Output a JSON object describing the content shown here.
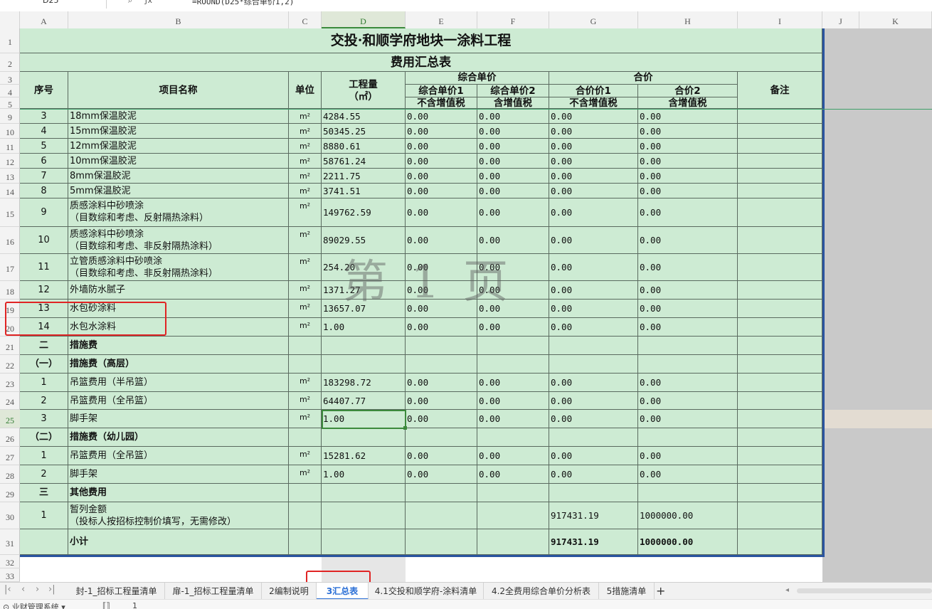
{
  "formula_bar": {
    "name_box": "D25",
    "formula": "=ROUND(D25*综合单价1,2)"
  },
  "columns": [
    "A",
    "B",
    "C",
    "D",
    "E",
    "F",
    "G",
    "H",
    "I",
    "J",
    "K"
  ],
  "title": {
    "line1": "交投·和顺学府地块一涂料工程",
    "line2": "费用汇总表"
  },
  "headers": {
    "seq": "序号",
    "name": "项目名称",
    "unit": "单位",
    "qty": "工程量",
    "qty_unit": "（㎡）",
    "composite_price": "综合单价",
    "total_price": "合价",
    "remark": "备注",
    "price1": "综合单价1",
    "price2": "综合单价2",
    "sum1": "合价价1",
    "sum2": "合价2",
    "ex_tax": "不含增值税",
    "inc_tax": "含增值税",
    "ex_tax2": "不含增值税",
    "inc_tax2": "含增值税"
  },
  "rows": [
    {
      "row": "9",
      "seq": "3",
      "name": "18mm保温胶泥",
      "unit": "m²",
      "qty": "4284.55",
      "p1": "0.00",
      "p2": "0.00",
      "s1": "0.00",
      "s2": "0.00"
    },
    {
      "row": "10",
      "seq": "4",
      "name": "15mm保温胶泥",
      "unit": "m²",
      "qty": "50345.25",
      "p1": "0.00",
      "p2": "0.00",
      "s1": "0.00",
      "s2": "0.00"
    },
    {
      "row": "11",
      "seq": "5",
      "name": "12mm保温胶泥",
      "unit": "m²",
      "qty": "8880.61",
      "p1": "0.00",
      "p2": "0.00",
      "s1": "0.00",
      "s2": "0.00"
    },
    {
      "row": "12",
      "seq": "6",
      "name": "10mm保温胶泥",
      "unit": "m²",
      "qty": "58761.24",
      "p1": "0.00",
      "p2": "0.00",
      "s1": "0.00",
      "s2": "0.00"
    },
    {
      "row": "13",
      "seq": "7",
      "name": "8mm保温胶泥",
      "unit": "m²",
      "qty": "2211.75",
      "p1": "0.00",
      "p2": "0.00",
      "s1": "0.00",
      "s2": "0.00"
    },
    {
      "row": "14",
      "seq": "8",
      "name": "5mm保温胶泥",
      "unit": "m²",
      "qty": "3741.51",
      "p1": "0.00",
      "p2": "0.00",
      "s1": "0.00",
      "s2": "0.00"
    },
    {
      "row": "15",
      "seq": "9",
      "name": "质感涂料中砂喷涂",
      "name2": "（目数综和考虑、反射隔热涂料）",
      "unit": "m²",
      "qty": "149762.59",
      "p1": "0.00",
      "p2": "0.00",
      "s1": "0.00",
      "s2": "0.00"
    },
    {
      "row": "16",
      "seq": "10",
      "name": "质感涂料中砂喷涂",
      "name2": "（目数综和考虑、非反射隔热涂料）",
      "unit": "m²",
      "qty": "89029.55",
      "p1": "0.00",
      "p2": "0.00",
      "s1": "0.00",
      "s2": "0.00"
    },
    {
      "row": "17",
      "seq": "11",
      "name": "立管质感涂料中砂喷涂",
      "name2": "（目数综和考虑、非反射隔热涂料）",
      "unit": "m²",
      "qty": "254.20",
      "p1": "0.00",
      "p2": "0.00",
      "s1": "0.00",
      "s2": "0.00"
    },
    {
      "row": "18",
      "seq": "12",
      "name": "外墙防水腻子",
      "unit": "m²",
      "qty": "1371.27",
      "p1": "0.00",
      "p2": "0.00",
      "s1": "0.00",
      "s2": "0.00"
    },
    {
      "row": "19",
      "seq": "13",
      "name": "水包砂涂料",
      "unit": "m²",
      "qty": "13657.07",
      "p1": "0.00",
      "p2": "0.00",
      "s1": "0.00",
      "s2": "0.00"
    },
    {
      "row": "20",
      "seq": "14",
      "name": "水包水涂料",
      "unit": "m²",
      "qty": "1.00",
      "p1": "0.00",
      "p2": "0.00",
      "s1": "0.00",
      "s2": "0.00"
    },
    {
      "row": "21",
      "seq": "二",
      "name": "措施费",
      "bold": true
    },
    {
      "row": "22",
      "seq": "（一）",
      "name": "措施费（高层）",
      "bold": true
    },
    {
      "row": "23",
      "seq": "1",
      "name": "吊篮费用（半吊篮）",
      "unit": "m²",
      "qty": "183298.72",
      "p1": "0.00",
      "p2": "0.00",
      "s1": "0.00",
      "s2": "0.00"
    },
    {
      "row": "24",
      "seq": "2",
      "name": "吊篮费用（全吊篮）",
      "unit": "m²",
      "qty": "64407.77",
      "p1": "0.00",
      "p2": "0.00",
      "s1": "0.00",
      "s2": "0.00"
    },
    {
      "row": "25",
      "seq": "3",
      "name": "脚手架",
      "unit": "m²",
      "qty": "1.00",
      "p1": "0.00",
      "p2": "0.00",
      "s1": "0.00",
      "s2": "0.00"
    },
    {
      "row": "26",
      "seq": "（二）",
      "name": "措施费（幼儿园）",
      "bold": true
    },
    {
      "row": "27",
      "seq": "1",
      "name": "吊篮费用（全吊篮）",
      "unit": "m²",
      "qty": "15281.62",
      "p1": "0.00",
      "p2": "0.00",
      "s1": "0.00",
      "s2": "0.00"
    },
    {
      "row": "28",
      "seq": "2",
      "name": "脚手架",
      "unit": "m²",
      "qty": "1.00",
      "p1": "0.00",
      "p2": "0.00",
      "s1": "0.00",
      "s2": "0.00"
    },
    {
      "row": "29",
      "seq": "三",
      "name": "其他费用",
      "bold": true
    },
    {
      "row": "30",
      "seq": "1",
      "name": "暂列金额",
      "name2": "（投标人按招标控制价填写，无需修改）",
      "s1": "917431.19",
      "s2": "1000000.00"
    },
    {
      "row": "31",
      "seq": "",
      "name": "小计",
      "s1": "917431.19",
      "s2": "1000000.00",
      "bold": true
    }
  ],
  "watermark": "第 1 页",
  "sheet_tabs": [
    "封-1_招标工程量清单",
    "扉-1_招标工程量清单",
    "2编制说明",
    "3汇总表",
    "4.1交投和顺学府-涂料清单",
    "4.2全费用综合单价分析表",
    "5措施清单"
  ],
  "active_tab": "3汇总表",
  "add_tab": "+",
  "statusbar": {
    "left": "⊙ 业财管理系统 ▾",
    "mid1": "⟦⟧",
    "mid2": "1"
  },
  "colors": {
    "table_bg": "#cdebd3",
    "border_blue": "#2a55a0",
    "selection": "#3c8a3c",
    "annotation": "#e02424"
  }
}
